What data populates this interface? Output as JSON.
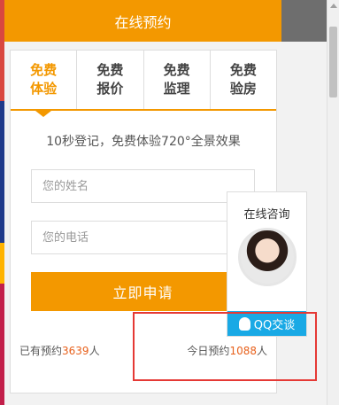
{
  "header": {
    "title": "在线预约"
  },
  "tabs": [
    {
      "line1": "免费",
      "line2": "体验",
      "active": true
    },
    {
      "line1": "免费",
      "line2": "报价",
      "active": false
    },
    {
      "line1": "免费",
      "line2": "监理",
      "active": false
    },
    {
      "line1": "免费",
      "line2": "验房",
      "active": false
    }
  ],
  "form": {
    "description": "10秒登记，免费体验720°全景效果",
    "name_placeholder": "您的姓名",
    "phone_placeholder": "您的电话",
    "submit_label": "立即申请"
  },
  "stats": {
    "total_prefix": "已有预约",
    "total_count": "3639",
    "total_suffix": "人",
    "today_prefix": "今日预约",
    "today_count": "1088",
    "today_suffix": "人"
  },
  "consult": {
    "title": "在线咨询",
    "qq_label": "QQ交谈"
  },
  "colors": {
    "accent": "#f39800",
    "number": "#e8611c",
    "qq_blue": "#19a9e5",
    "highlight_border": "#e53935"
  }
}
